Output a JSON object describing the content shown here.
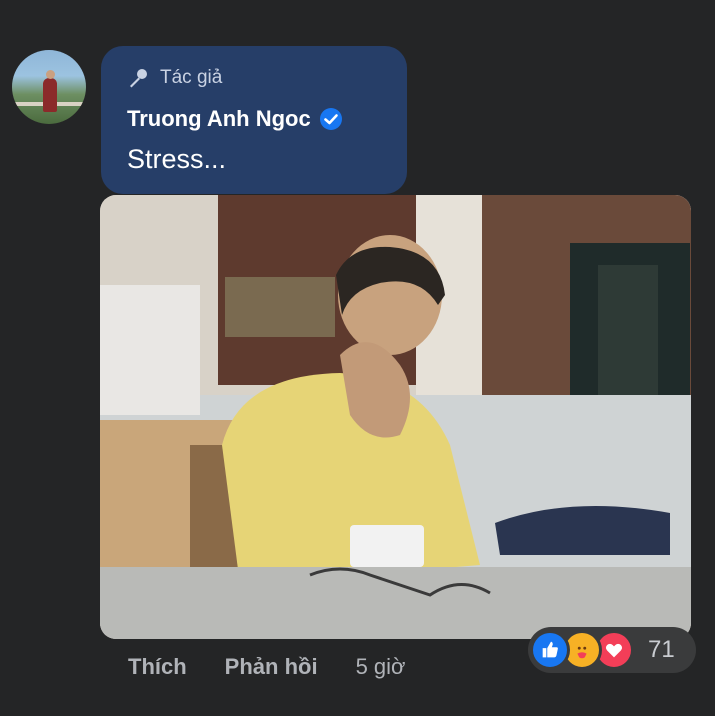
{
  "comment": {
    "badge": "Tác giả",
    "author": "Truong Anh Ngoc",
    "text": "Stress..."
  },
  "actions": {
    "like_label": "Thích",
    "reply_label": "Phản hồi",
    "timestamp": "5 giờ"
  },
  "reactions": {
    "types": [
      "like",
      "care",
      "love"
    ],
    "count": "71"
  },
  "icons": {
    "badge": "microphone-icon",
    "verified": "verified-badge-icon"
  },
  "colors": {
    "background": "#242526",
    "bubble": "#263e68",
    "verified": "#1877f2"
  }
}
